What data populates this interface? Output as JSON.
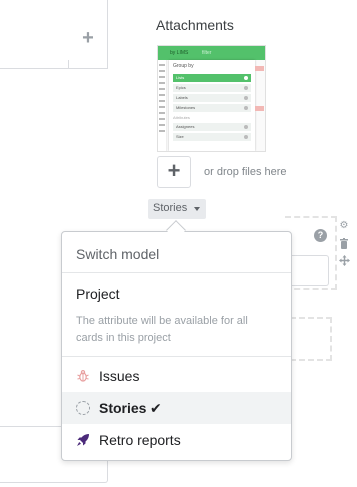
{
  "attachments": {
    "title": "Attachments",
    "drop_hint": "or drop files here",
    "thumbnail": {
      "toolbar_left": "by LIMS",
      "toolbar_right": "filter",
      "group_by": "Group by",
      "rows": [
        "Lists",
        "Epics",
        "Labels",
        "Milestones"
      ],
      "subheading": "Attributes",
      "rows2": [
        "Assignees",
        "Size"
      ]
    }
  },
  "trigger": {
    "label": "Stories"
  },
  "popover": {
    "title": "Switch model",
    "project": {
      "title": "Project",
      "description": "The attribute will be available for all cards in this project"
    },
    "options": [
      {
        "label": "Issues",
        "icon": "bug-icon",
        "color": "#e8a0a0"
      },
      {
        "label": "Stories",
        "icon": "dashed-circle-icon",
        "selected": true
      },
      {
        "label": "Retro reports",
        "icon": "rocket-icon",
        "color": "#4b2a7a"
      }
    ],
    "check_glyph": "✔"
  },
  "colors": {
    "accent_green": "#53c16b",
    "muted_text": "#9aa0a6",
    "selected_bg": "#f1f3f4"
  }
}
